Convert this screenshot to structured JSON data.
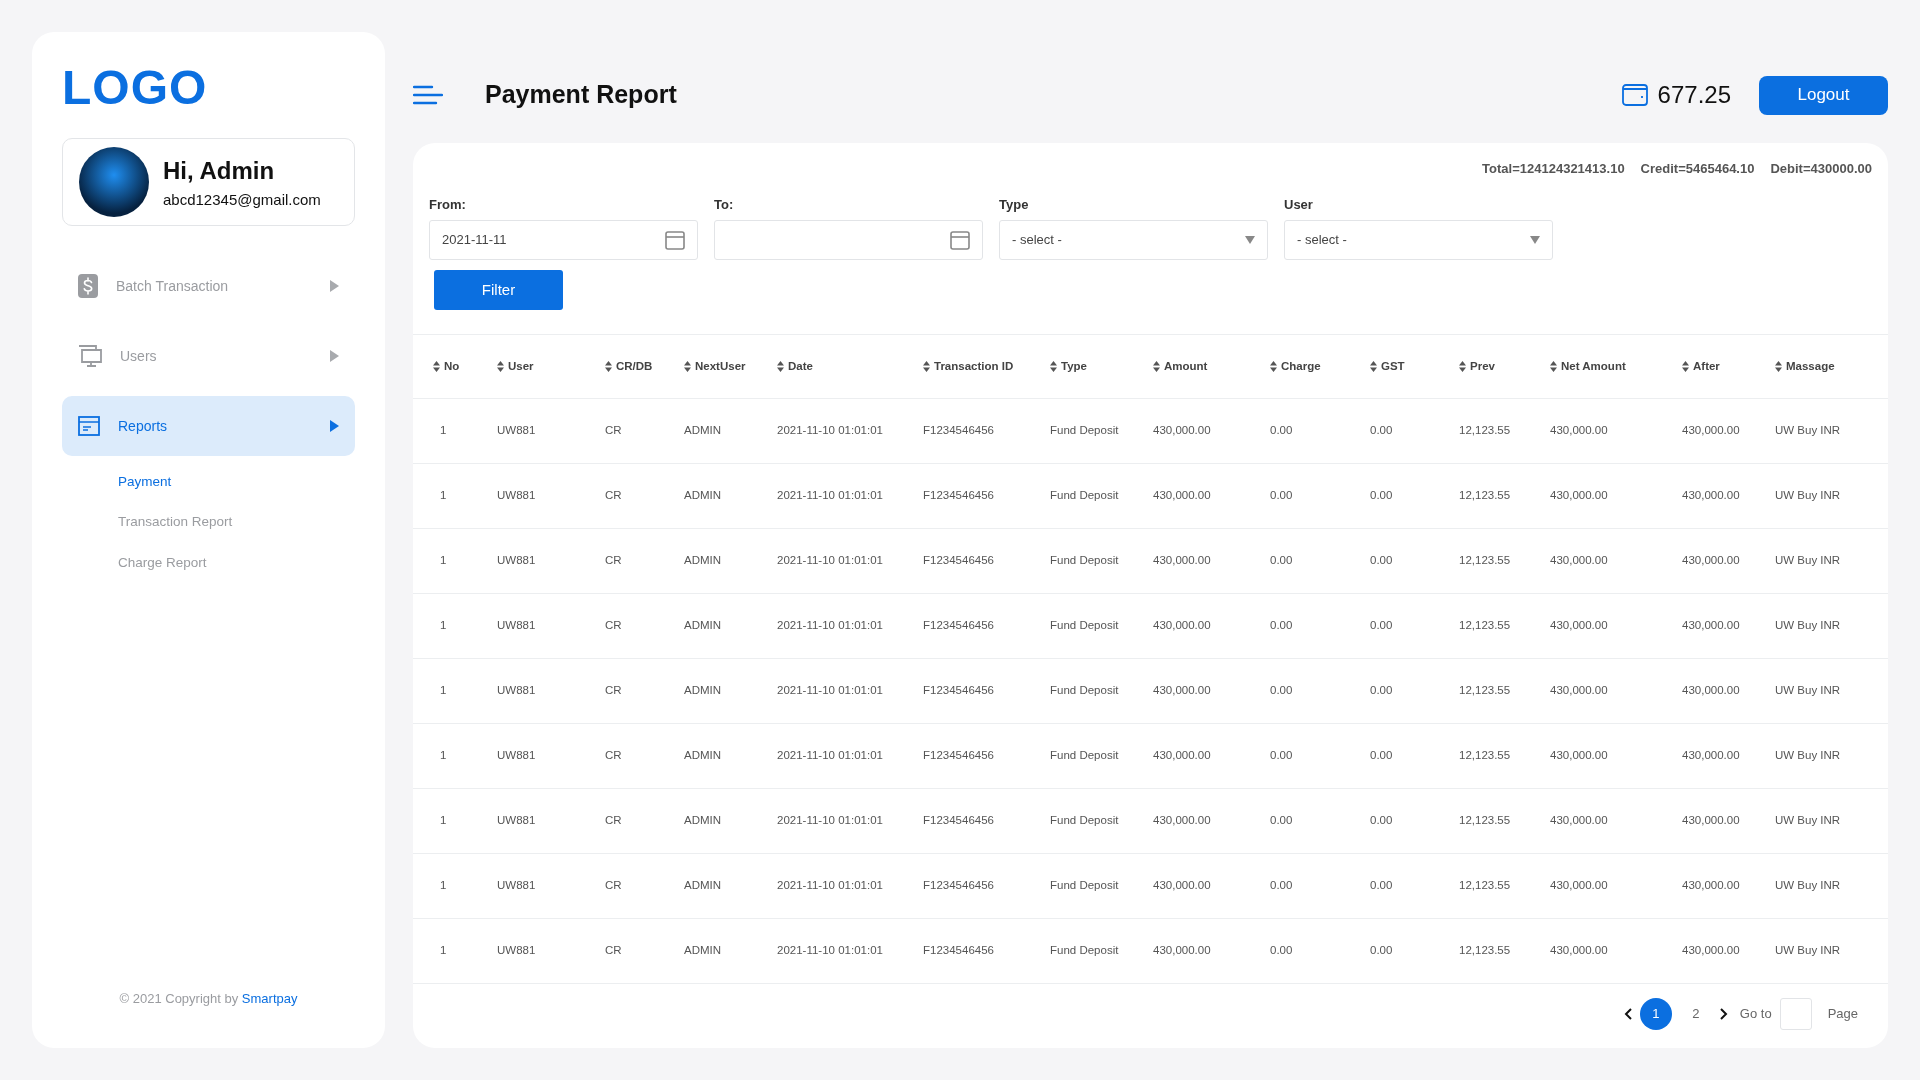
{
  "sidebar": {
    "logo": "LOGO",
    "profile": {
      "greeting": "Hi, Admin",
      "email": "abcd12345@gmail.com"
    },
    "items": [
      {
        "label": "Batch Transaction",
        "selected": false,
        "expanded": false
      },
      {
        "label": "Users",
        "selected": false,
        "expanded": false
      },
      {
        "label": "Reports",
        "selected": true,
        "expanded": true,
        "children": [
          {
            "label": "Payment",
            "selected": true
          },
          {
            "label": "Transaction Report",
            "selected": false
          },
          {
            "label": "Charge Report",
            "selected": false
          }
        ]
      }
    ],
    "footer": {
      "text": "© 2021 Copyright by",
      "link": "Smartpay"
    }
  },
  "header": {
    "title": "Payment Report",
    "balance": "677.25",
    "logout": "Logout"
  },
  "totals": [
    "Total=124124321413.10",
    "Credit=5465464.10",
    "Debit=430000.00"
  ],
  "filters": [
    {
      "label": "From:",
      "kind": "date",
      "value": "2021-11-11"
    },
    {
      "label": "To:",
      "kind": "date"
    },
    {
      "label": "Type",
      "kind": "select",
      "value": "- select -"
    },
    {
      "label": "User",
      "kind": "select",
      "value": "- select -"
    }
  ],
  "filter_button": "Filter",
  "table": {
    "columns": [
      "No",
      "User",
      "CR/DB",
      "NextUser",
      "Date",
      "Transaction ID",
      "Type",
      "Amount",
      "Charge",
      "GST",
      "Prev",
      "Net Amount",
      "After",
      "Massage"
    ],
    "rows": [
      [
        "1",
        "UW881",
        "CR",
        "ADMIN",
        "2021-11-10 01:01:01",
        "F1234546456",
        "Fund Deposit",
        "430,000.00",
        "0.00",
        "0.00",
        "12,123.55",
        "430,000.00",
        "430,000.00",
        "UW Buy INR"
      ],
      [
        "1",
        "UW881",
        "CR",
        "ADMIN",
        "2021-11-10 01:01:01",
        "F1234546456",
        "Fund Deposit",
        "430,000.00",
        "0.00",
        "0.00",
        "12,123.55",
        "430,000.00",
        "430,000.00",
        "UW Buy INR"
      ],
      [
        "1",
        "UW881",
        "CR",
        "ADMIN",
        "2021-11-10 01:01:01",
        "F1234546456",
        "Fund Deposit",
        "430,000.00",
        "0.00",
        "0.00",
        "12,123.55",
        "430,000.00",
        "430,000.00",
        "UW Buy INR"
      ],
      [
        "1",
        "UW881",
        "CR",
        "ADMIN",
        "2021-11-10 01:01:01",
        "F1234546456",
        "Fund Deposit",
        "430,000.00",
        "0.00",
        "0.00",
        "12,123.55",
        "430,000.00",
        "430,000.00",
        "UW Buy INR"
      ],
      [
        "1",
        "UW881",
        "CR",
        "ADMIN",
        "2021-11-10 01:01:01",
        "F1234546456",
        "Fund Deposit",
        "430,000.00",
        "0.00",
        "0.00",
        "12,123.55",
        "430,000.00",
        "430,000.00",
        "UW Buy INR"
      ],
      [
        "1",
        "UW881",
        "CR",
        "ADMIN",
        "2021-11-10 01:01:01",
        "F1234546456",
        "Fund Deposit",
        "430,000.00",
        "0.00",
        "0.00",
        "12,123.55",
        "430,000.00",
        "430,000.00",
        "UW Buy INR"
      ],
      [
        "1",
        "UW881",
        "CR",
        "ADMIN",
        "2021-11-10 01:01:01",
        "F1234546456",
        "Fund Deposit",
        "430,000.00",
        "0.00",
        "0.00",
        "12,123.55",
        "430,000.00",
        "430,000.00",
        "UW Buy INR"
      ],
      [
        "1",
        "UW881",
        "CR",
        "ADMIN",
        "2021-11-10 01:01:01",
        "F1234546456",
        "Fund Deposit",
        "430,000.00",
        "0.00",
        "0.00",
        "12,123.55",
        "430,000.00",
        "430,000.00",
        "UW Buy INR"
      ],
      [
        "1",
        "UW881",
        "CR",
        "ADMIN",
        "2021-11-10 01:01:01",
        "F1234546456",
        "Fund Deposit",
        "430,000.00",
        "0.00",
        "0.00",
        "12,123.55",
        "430,000.00",
        "430,000.00",
        "UW Buy INR"
      ]
    ]
  },
  "pagination": {
    "pages": [
      {
        "label": "1",
        "selected": true
      },
      {
        "label": "2",
        "selected": false
      }
    ],
    "goto": "Go to",
    "page": "Page"
  }
}
